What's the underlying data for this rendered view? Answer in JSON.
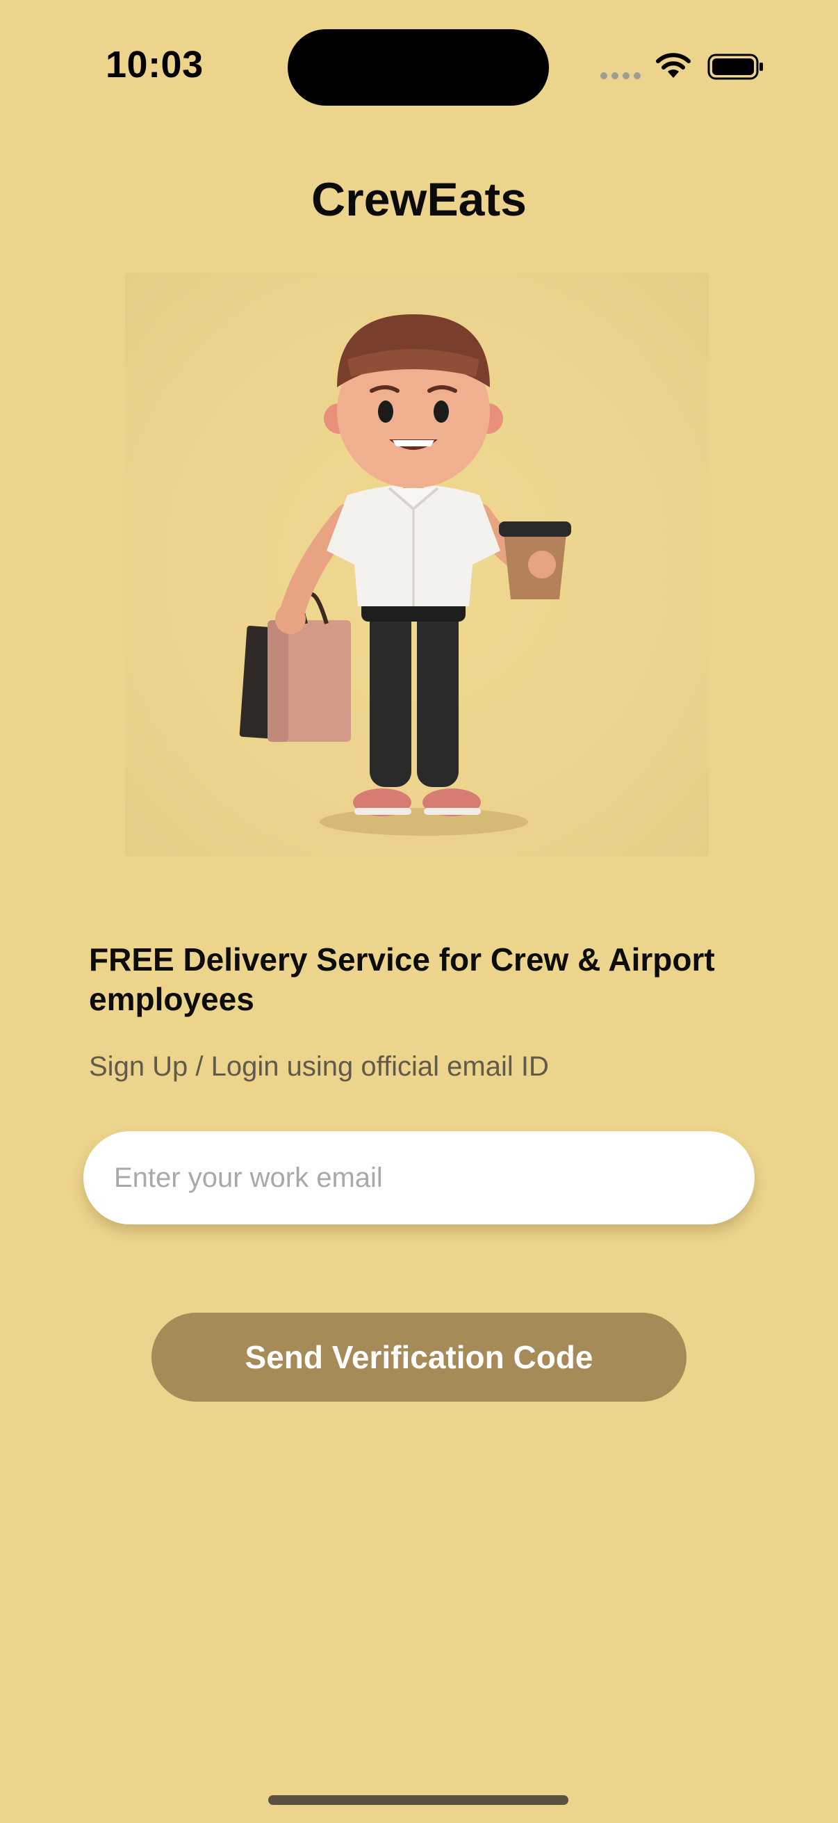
{
  "status_bar": {
    "time": "10:03"
  },
  "app": {
    "title": "CrewEats"
  },
  "hero": {
    "illustration": "delivery-person-with-shopping-bags-and-coffee"
  },
  "content": {
    "headline": "FREE Delivery Service for Crew & Airport employees",
    "subtitle": "Sign Up / Login using official email ID"
  },
  "form": {
    "email_value": "",
    "email_placeholder": "Enter your work email",
    "submit_label": "Send Verification Code"
  },
  "colors": {
    "background": "#ecd48c",
    "button": "#a68a57",
    "input": "#ffffff"
  }
}
